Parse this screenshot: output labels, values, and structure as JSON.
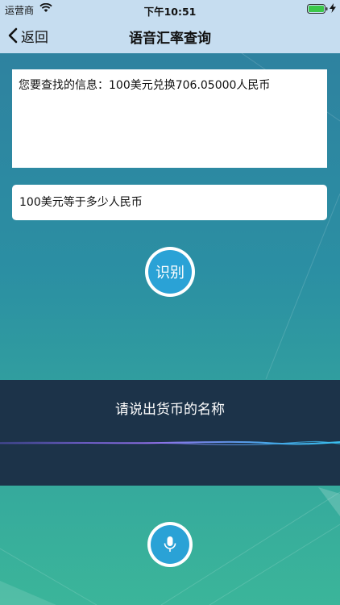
{
  "status_bar": {
    "carrier": "运营商",
    "time": "下午10:51",
    "wifi_icon": "wifi-icon",
    "battery_icon": "battery-icon",
    "charging_icon": "bolt-icon"
  },
  "nav": {
    "back_label": "返回",
    "back_icon": "chevron-left-icon",
    "title": "语音汇率查询"
  },
  "result": {
    "text": "您要查找的信息：100美元兑换706.05000人民币"
  },
  "query": {
    "value": "100美元等于多少人民币"
  },
  "recognize_button": {
    "label": "识别"
  },
  "voice": {
    "prompt": "请说出货币的名称",
    "mic_icon": "microphone-icon"
  },
  "colors": {
    "accent": "#2aa2d6",
    "nav_bg": "#c6ddf0",
    "panel_bg": "#1c3349"
  }
}
